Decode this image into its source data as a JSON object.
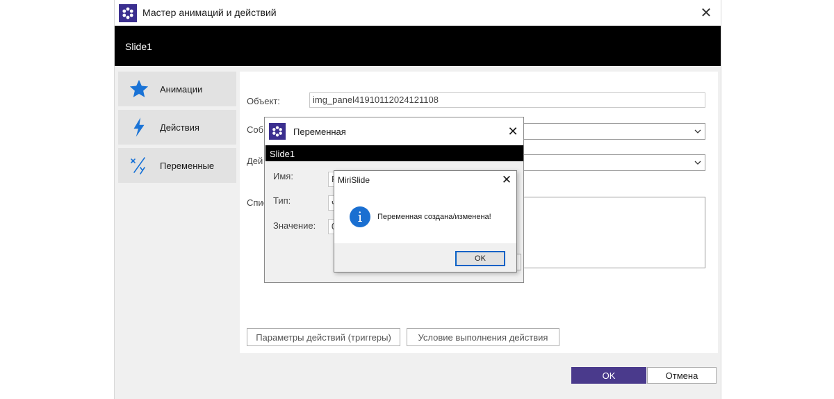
{
  "window": {
    "title": "Мастер анимаций и действий",
    "close_glyph": "✕",
    "slide_name": "Slide1"
  },
  "sidebar": {
    "items": [
      {
        "label": "Анимации",
        "icon": "star-icon"
      },
      {
        "label": "Действия",
        "icon": "lightning-icon"
      },
      {
        "label": "Переменные",
        "icon": "variables-icon"
      }
    ]
  },
  "form": {
    "object_label": "Объект:",
    "object_value": "img_panel41910112024121108",
    "event_label_partial": "Собы",
    "action_label_partial": "Дей",
    "list_label_partial": "Спис",
    "triggers_button": "Параметры действий (триггеры)",
    "condition_button": "Условие выполнения действия"
  },
  "footer": {
    "ok_label": "OK",
    "cancel_label": "Отмена"
  },
  "variable_dialog": {
    "title": "Переменная",
    "close_glyph": "✕",
    "slide_name": "Slide1",
    "name_label": "Имя:",
    "name_value_partial": "P",
    "type_label": "Тип:",
    "type_value_partial": "ч",
    "value_label": "Значение:",
    "value_value_partial": "0"
  },
  "message_box": {
    "title": "MiriSlide",
    "close_glyph": "✕",
    "icon_glyph": "i",
    "message": "Переменная создана/изменена!",
    "ok_label": "OK"
  },
  "colors": {
    "accent": "#4a3a8c",
    "app_icon_bg": "#3b2f8f",
    "slide_bar": "#000000",
    "sidebar_icon": "#1a73d6",
    "info_icon": "#1a6fd1"
  }
}
